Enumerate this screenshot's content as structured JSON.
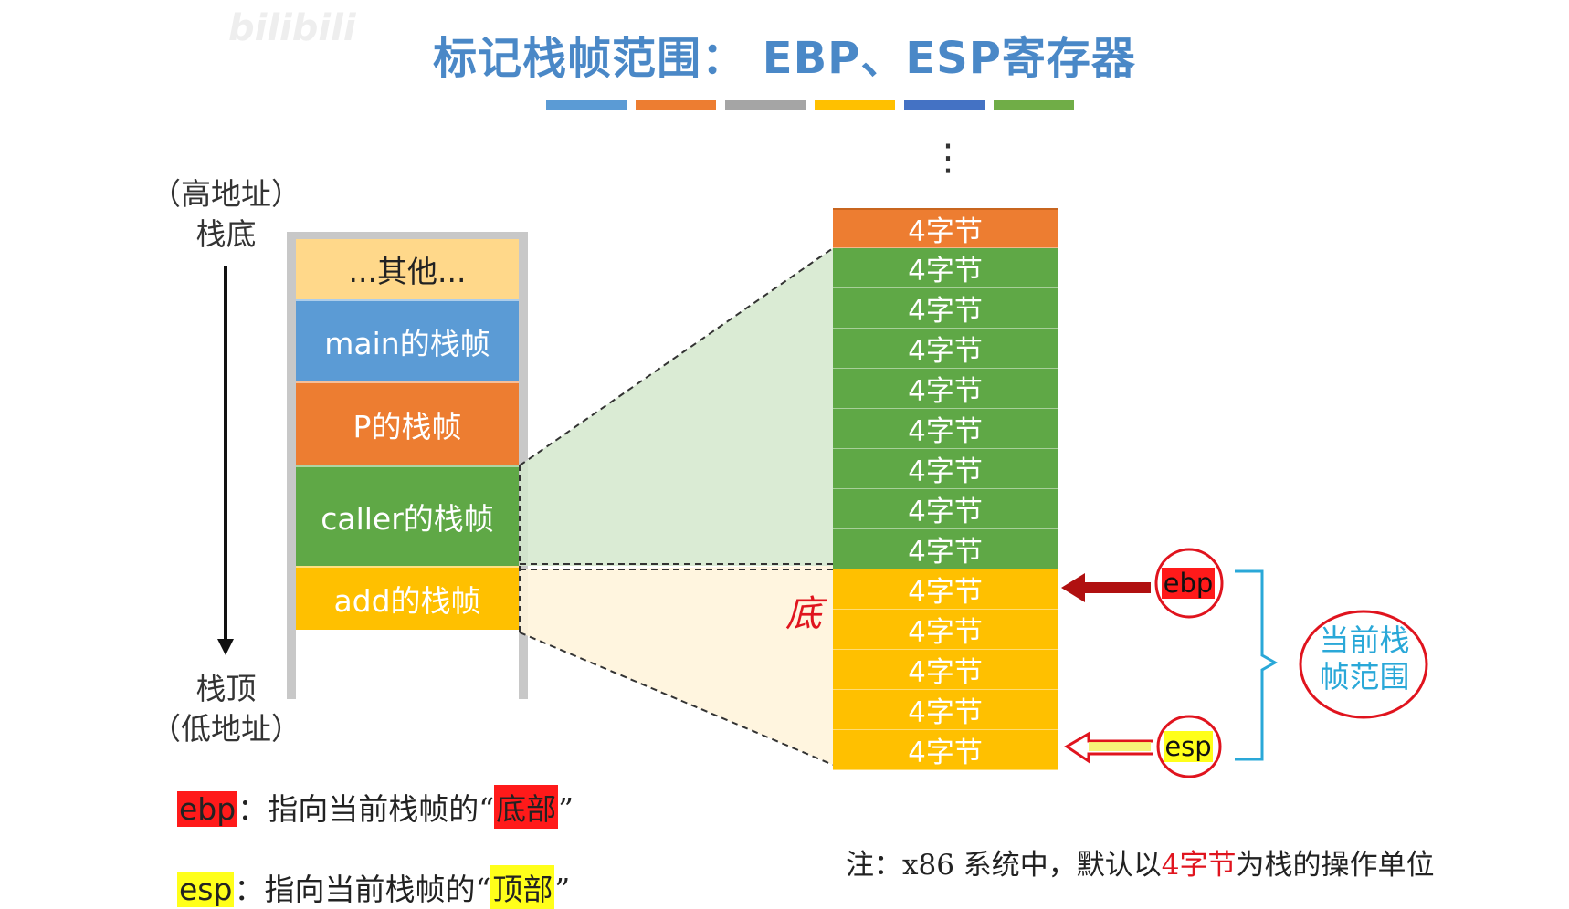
{
  "watermark": "bilibili",
  "title": "标记栈帧范围： EBP、ESP寄存器",
  "colors": {
    "title": "#4a88c7",
    "bars": [
      "#5b9bd5",
      "#ed7d31",
      "#a5a5a5",
      "#ffc000",
      "#4472c4",
      "#70ad47"
    ],
    "other": "#ffd88a",
    "main": "#5b9bd5",
    "p": "#ed7d31",
    "caller": "#5fa846",
    "add": "#ffc000",
    "ebp_highlight": "#ff1a1a",
    "esp_highlight": "#ffff1a",
    "annotation": "#e0141e",
    "brace": "#2aa8d8"
  },
  "left_labels": {
    "high_addr": "（高地址）",
    "stack_bottom": "栈底",
    "stack_top": "栈顶",
    "low_addr": "（低地址）"
  },
  "stack_frames": [
    {
      "label": "...其他...",
      "color_key": "other",
      "text_color": "#222222"
    },
    {
      "label": "main的栈帧",
      "color_key": "main",
      "text_color": "#ffffff"
    },
    {
      "label": "P的栈帧",
      "color_key": "p",
      "text_color": "#ffffff"
    },
    {
      "label": "caller的栈帧",
      "color_key": "caller",
      "text_color": "#ffffff"
    },
    {
      "label": "add的栈帧",
      "color_key": "add",
      "text_color": "#ffffff"
    }
  ],
  "ellipsis": "⋮",
  "cells": [
    {
      "label": "4字节",
      "group": "p"
    },
    {
      "label": "4字节",
      "group": "caller"
    },
    {
      "label": "4字节",
      "group": "caller"
    },
    {
      "label": "4字节",
      "group": "caller"
    },
    {
      "label": "4字节",
      "group": "caller"
    },
    {
      "label": "4字节",
      "group": "caller"
    },
    {
      "label": "4字节",
      "group": "caller"
    },
    {
      "label": "4字节",
      "group": "caller"
    },
    {
      "label": "4字节",
      "group": "caller"
    },
    {
      "label": "4字节",
      "group": "add"
    },
    {
      "label": "4字节",
      "group": "add"
    },
    {
      "label": "4字节",
      "group": "add"
    },
    {
      "label": "4字节",
      "group": "add"
    },
    {
      "label": "4字节",
      "group": "add"
    }
  ],
  "handwritten_bottom": "底",
  "registers": {
    "ebp": "ebp",
    "esp": "esp"
  },
  "brace_label_line1": "当前栈",
  "brace_label_line2": "帧范围",
  "legend": {
    "ebp_tag": "ebp",
    "ebp_text": "：指向当前栈帧的“",
    "ebp_word": "底部",
    "ebp_close": "”",
    "esp_tag": "esp",
    "esp_text": "：指向当前栈帧的“",
    "esp_word": "顶部",
    "esp_close": "”"
  },
  "note": {
    "prefix": "注：x86 系统中，默认以",
    "highlight": "4字节",
    "suffix": "为栈的操作单位"
  }
}
